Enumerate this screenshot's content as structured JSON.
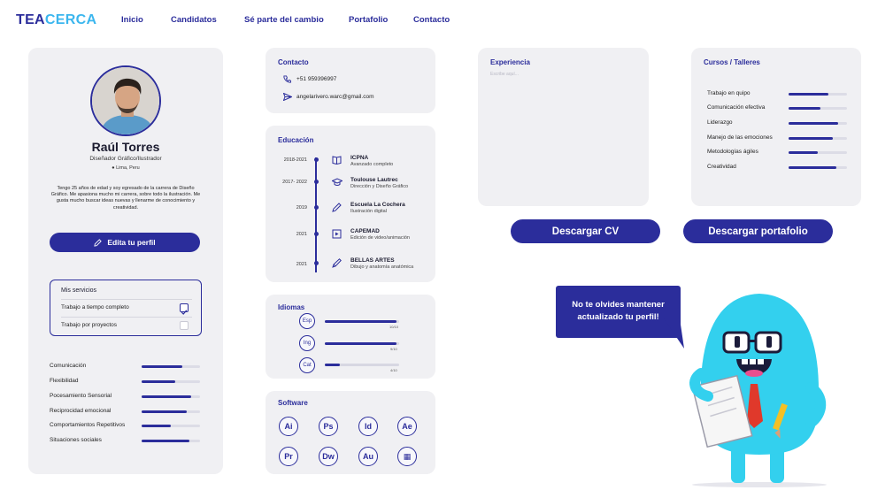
{
  "nav": {
    "logo_a": "TEA",
    "logo_b": "CERCA",
    "links": [
      "Inicio",
      "Candidatos",
      "Sé parte del cambio",
      "Portafolio",
      "Contacto"
    ]
  },
  "profile": {
    "name": "Raúl Torres",
    "role": "Diseñador Gráfico/Ilustrador",
    "location": "Lima, Peru",
    "bio": "Tengo 25 años de edad y soy egresado de la carrera de Diseño Gráfico. Me apasiona mucho mi carrera, sobre todo la ilustración. Me gusta mucho buscar ideas nuevas y llenarme de conocimiento y creatividad.",
    "edit_label": "Edita tu perfil",
    "services_title": "Mis servicios",
    "services": [
      {
        "label": "Trabajo a tiempo completo",
        "checked": true
      },
      {
        "label": "Trabajo por proyectos",
        "checked": false
      }
    ],
    "skills": [
      {
        "label": "Comunicación",
        "level": 0.7
      },
      {
        "label": "Flexibilidad",
        "level": 0.58
      },
      {
        "label": "Pocesamiento Sensorial",
        "level": 0.85
      },
      {
        "label": "Reciprocidad emocional",
        "level": 0.78
      },
      {
        "label": "Comportamientos Repetitivos",
        "level": 0.5
      },
      {
        "label": "Situaciones sociales",
        "level": 0.82
      }
    ]
  },
  "contact": {
    "title": "Contacto",
    "phone": "+51 959396997",
    "email": "angelarivero.warc@gmail.com"
  },
  "education": {
    "title": "Educación",
    "items": [
      {
        "year": "2018-2021",
        "institution": "ICPNA",
        "detail": "Avanzado completo",
        "icon": "book-icon"
      },
      {
        "year": "2017- 2022",
        "institution": "Toulouse Lautrec",
        "detail": "Dirección y Diseño Gráfico",
        "icon": "graduation-cap-icon"
      },
      {
        "year": "2019",
        "institution": "Escuela La Cochera",
        "detail": "Ilustración digital",
        "icon": "pencil-icon"
      },
      {
        "year": "2021",
        "institution": "CAPEMAD",
        "detail": "Edición de video/animación",
        "icon": "video-icon"
      },
      {
        "year": "2021",
        "institution": "BELLAS ARTES",
        "detail": "Dibujo y anatomía anatómica",
        "icon": "pen-icon"
      }
    ]
  },
  "languages": {
    "title": "Idiomas",
    "items": [
      {
        "code": "Esp",
        "level": 0.97,
        "score": "10/10"
      },
      {
        "code": "Ing",
        "level": 0.96,
        "score": "9/10"
      },
      {
        "code": "Cat",
        "level": 0.2,
        "score": "4/10"
      }
    ]
  },
  "software": {
    "title": "Software",
    "items": [
      "Ai",
      "Ps",
      "Id",
      "Ae",
      "Pr",
      "Dw",
      "Au",
      "▦"
    ]
  },
  "experience": {
    "title": "Experiencia",
    "placeholder": "Escribe aquí..."
  },
  "courses": {
    "title": "Cursos / Talleres",
    "items": [
      {
        "label": "Trabajo en quipo",
        "level": 0.68
      },
      {
        "label": "Comunicación efectiva",
        "level": 0.55
      },
      {
        "label": "Liderazgo",
        "level": 0.85
      },
      {
        "label": "Manejo de las emociones",
        "level": 0.75
      },
      {
        "label": "Metodologías ágiles",
        "level": 0.5
      },
      {
        "label": "Creatividad",
        "level": 0.82
      }
    ]
  },
  "actions": {
    "download_cv": "Descargar CV",
    "download_portfolio": "Descargar portafolio"
  },
  "mascot": {
    "bubble": "No te olvides mantener actualizado tu perfil!"
  },
  "colors": {
    "primary": "#2b2d9b",
    "accent": "#3bb6ee",
    "card": "#f0f0f3",
    "mascot": "#33d0ee"
  }
}
